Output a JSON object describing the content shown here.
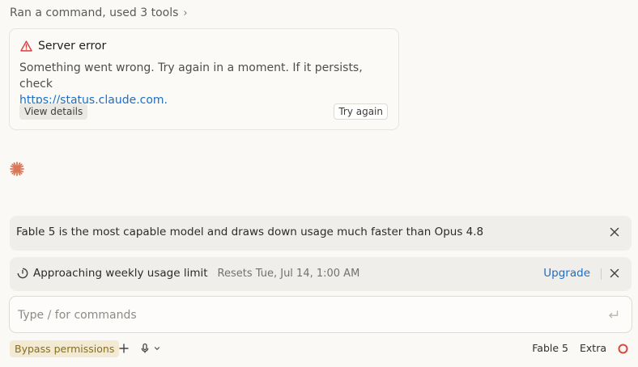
{
  "tools_summary": {
    "label": "Ran a command, used 3 tools",
    "chevron": "›"
  },
  "error_card": {
    "title": "Server error",
    "message": "Something went wrong. Try again in a moment. If it persists, check",
    "link": "https://status.claude.com.",
    "details_label": "View details",
    "retry_label": "Try again",
    "icon": "warning-triangle-icon",
    "icon_color": "#d64242"
  },
  "spinner": {
    "icon": "spark-icon",
    "color": "#d97757"
  },
  "banners": {
    "model_notice": "Fable 5 is the most capable model and draws down usage much faster than Opus 4.8",
    "usage_limit": {
      "label": "Approaching weekly usage limit",
      "reset": "Resets Tue, Jul 14, 1:00 AM",
      "upgrade_label": "Upgrade"
    }
  },
  "composer": {
    "placeholder": "Type / for commands",
    "value": ""
  },
  "footer": {
    "mode_label": "Bypass permissions",
    "model_label": "Fable 5",
    "extra_label": "Extra",
    "status_color": "#d9453f"
  },
  "colors": {
    "accent_link": "#1a6fc8",
    "background": "#faf9f6",
    "mode_bg": "#f2ead3",
    "mode_fg": "#8a6d1b"
  }
}
